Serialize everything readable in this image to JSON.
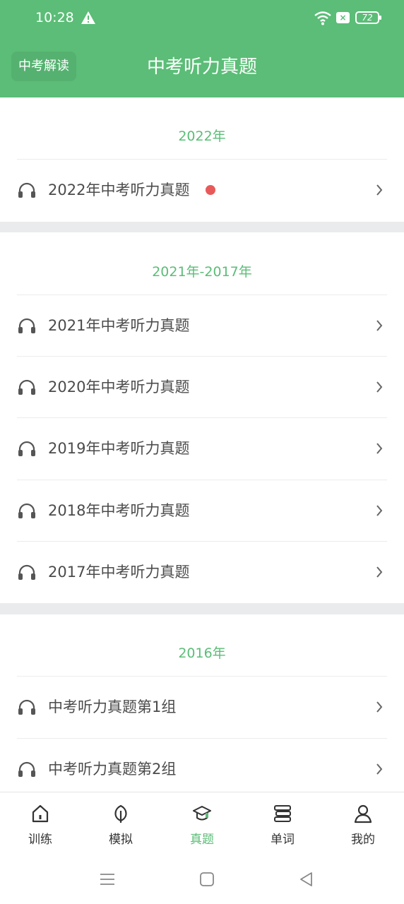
{
  "status_bar": {
    "time": "10:28",
    "battery": "72"
  },
  "header": {
    "left_button": "中考解读",
    "title": "中考听力真题"
  },
  "sections": [
    {
      "title": "2022年",
      "items": [
        {
          "label": "2022年中考听力真题",
          "new_dot": true
        }
      ]
    },
    {
      "title": "2021年-2017年",
      "items": [
        {
          "label": "2021年中考听力真题"
        },
        {
          "label": "2020年中考听力真题"
        },
        {
          "label": "2019年中考听力真题"
        },
        {
          "label": "2018年中考听力真题"
        },
        {
          "label": "2017年中考听力真题"
        }
      ]
    },
    {
      "title": "2016年",
      "items": [
        {
          "label": "中考听力真题第1组"
        },
        {
          "label": "中考听力真题第2组"
        }
      ]
    }
  ],
  "bottom_nav": [
    {
      "label": "训练",
      "icon": "home-icon"
    },
    {
      "label": "模拟",
      "icon": "leaf-icon"
    },
    {
      "label": "真题",
      "icon": "graduation-cap-icon",
      "active": true
    },
    {
      "label": "单词",
      "icon": "book-stack-icon"
    },
    {
      "label": "我的",
      "icon": "user-icon"
    }
  ],
  "colors": {
    "accent": "#5bbd77",
    "new_dot": "#e85a5a",
    "gap": "#e9ebec"
  }
}
